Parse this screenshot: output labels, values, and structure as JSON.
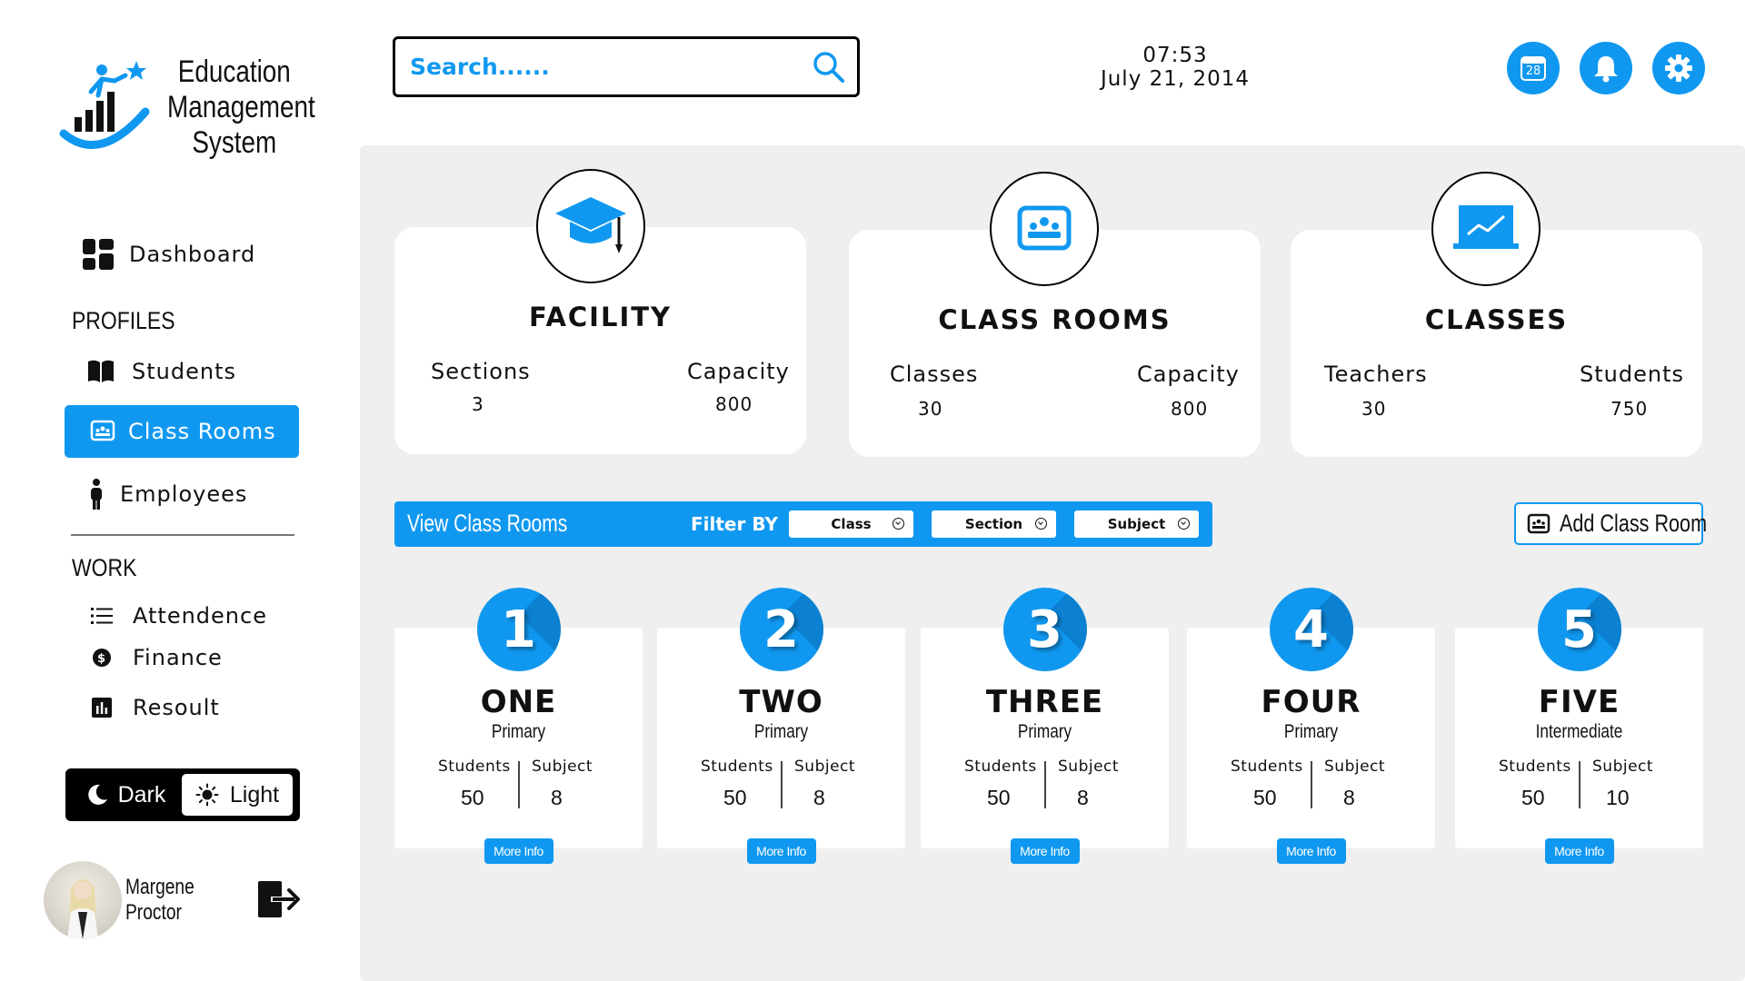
{
  "brand": {
    "line1": "Education",
    "line2": "Management",
    "line3": "System"
  },
  "nav": {
    "dashboard": "Dashboard",
    "profiles_label": "PROFILES",
    "students": "Students",
    "class_rooms": "Class Rooms",
    "employees": "Employees",
    "work_label": "WORK",
    "attendence": "Attendence",
    "finance": "Finance",
    "resoult": "Resoult"
  },
  "theme": {
    "dark": "Dark",
    "light": "Light"
  },
  "user": {
    "name": "Margene Proctor"
  },
  "search": {
    "placeholder": "Search......"
  },
  "clock": {
    "time": "07:53",
    "date": "July 21, 2014"
  },
  "calendar_day": "28",
  "stats": [
    {
      "title": "FACILITY",
      "left_label": "Sections",
      "left_value": "3",
      "right_label": "Capacity",
      "right_value": "800",
      "icon": "graduation-cap-icon"
    },
    {
      "title": "CLASS ROOMS",
      "left_label": "Classes",
      "left_value": "30",
      "right_label": "Capacity",
      "right_value": "800",
      "icon": "classroom-board-icon"
    },
    {
      "title": "CLASSES",
      "left_label": "Teachers",
      "left_value": "30",
      "right_label": "Students",
      "right_value": "750",
      "icon": "presentation-chart-icon"
    }
  ],
  "filter": {
    "title": "View Class Rooms",
    "filter_by": "Filter BY",
    "options": [
      "Class",
      "Section",
      "Subject"
    ]
  },
  "add_button": "Add Class Room",
  "classes": [
    {
      "number": "1",
      "name": "ONE",
      "level": "Primary",
      "students_label": "Students",
      "subject_label": "Subject",
      "students": "50",
      "subject": "8",
      "more": "More Info"
    },
    {
      "number": "2",
      "name": "TWO",
      "level": "Primary",
      "students_label": "Students",
      "subject_label": "Subject",
      "students": "50",
      "subject": "8",
      "more": "More Info"
    },
    {
      "number": "3",
      "name": "THREE",
      "level": "Primary",
      "students_label": "Students",
      "subject_label": "Subject",
      "students": "50",
      "subject": "8",
      "more": "More Info"
    },
    {
      "number": "4",
      "name": "FOUR",
      "level": "Primary",
      "students_label": "Students",
      "subject_label": "Subject",
      "students": "50",
      "subject": "8",
      "more": "More Info"
    },
    {
      "number": "5",
      "name": "FIVE",
      "level": "Intermediate",
      "students_label": "Students",
      "subject_label": "Subject",
      "students": "50",
      "subject": "10",
      "more": "More Info"
    }
  ],
  "colors": {
    "accent": "#1098f0",
    "panel": "#efefef",
    "dark": "#000000"
  }
}
